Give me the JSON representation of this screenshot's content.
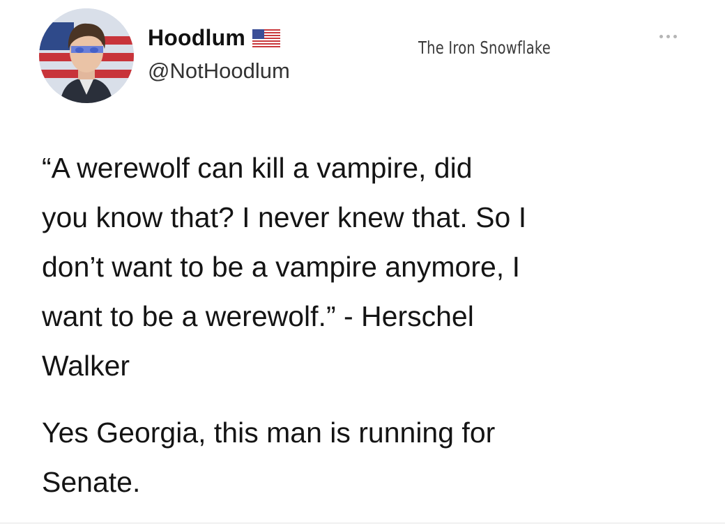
{
  "tweet": {
    "author": {
      "display_name": "Hoodlum",
      "handle": "@NotHoodlum",
      "badge_icon": "us-flag-icon"
    },
    "watermark": "The Iron Snowflake",
    "more_icon": "more-options-icon",
    "body_lines": [
      "“A werewolf can kill a vampire, did",
      "you know that? I never knew that. So I",
      "don’t want to be a vampire anymore, I",
      "want to be a werewolf.” - Herschel",
      "Walker"
    ],
    "body2_lines": [
      "Yes Georgia, this man is running for",
      "Senate."
    ]
  }
}
